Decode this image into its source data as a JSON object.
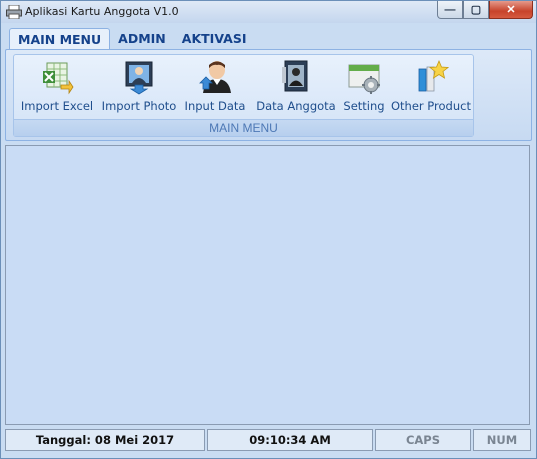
{
  "window": {
    "title": "Aplikasi Kartu Anggota V1.0",
    "controls": {
      "minimize": "—",
      "maximize": "▢",
      "close": "✕"
    }
  },
  "tabs": [
    {
      "label": "MAIN MENU",
      "active": true
    },
    {
      "label": "ADMIN",
      "active": false
    },
    {
      "label": "AKTIVASI",
      "active": false
    }
  ],
  "ribbon": {
    "group_label": "MAIN MENU",
    "buttons": [
      {
        "label": "Import Excel",
        "icon": "excel-import-icon"
      },
      {
        "label": "Import Photo",
        "icon": "photo-import-icon"
      },
      {
        "label": "Input Data",
        "icon": "user-add-icon"
      },
      {
        "label": "Data Anggota",
        "icon": "member-card-icon"
      },
      {
        "label": "Setting",
        "icon": "settings-icon"
      },
      {
        "label": "Other Product",
        "icon": "product-star-icon"
      }
    ]
  },
  "statusbar": {
    "date": "Tanggal: 08 Mei 2017",
    "time": "09:10:34 AM",
    "caps": "CAPS",
    "num": "NUM"
  }
}
